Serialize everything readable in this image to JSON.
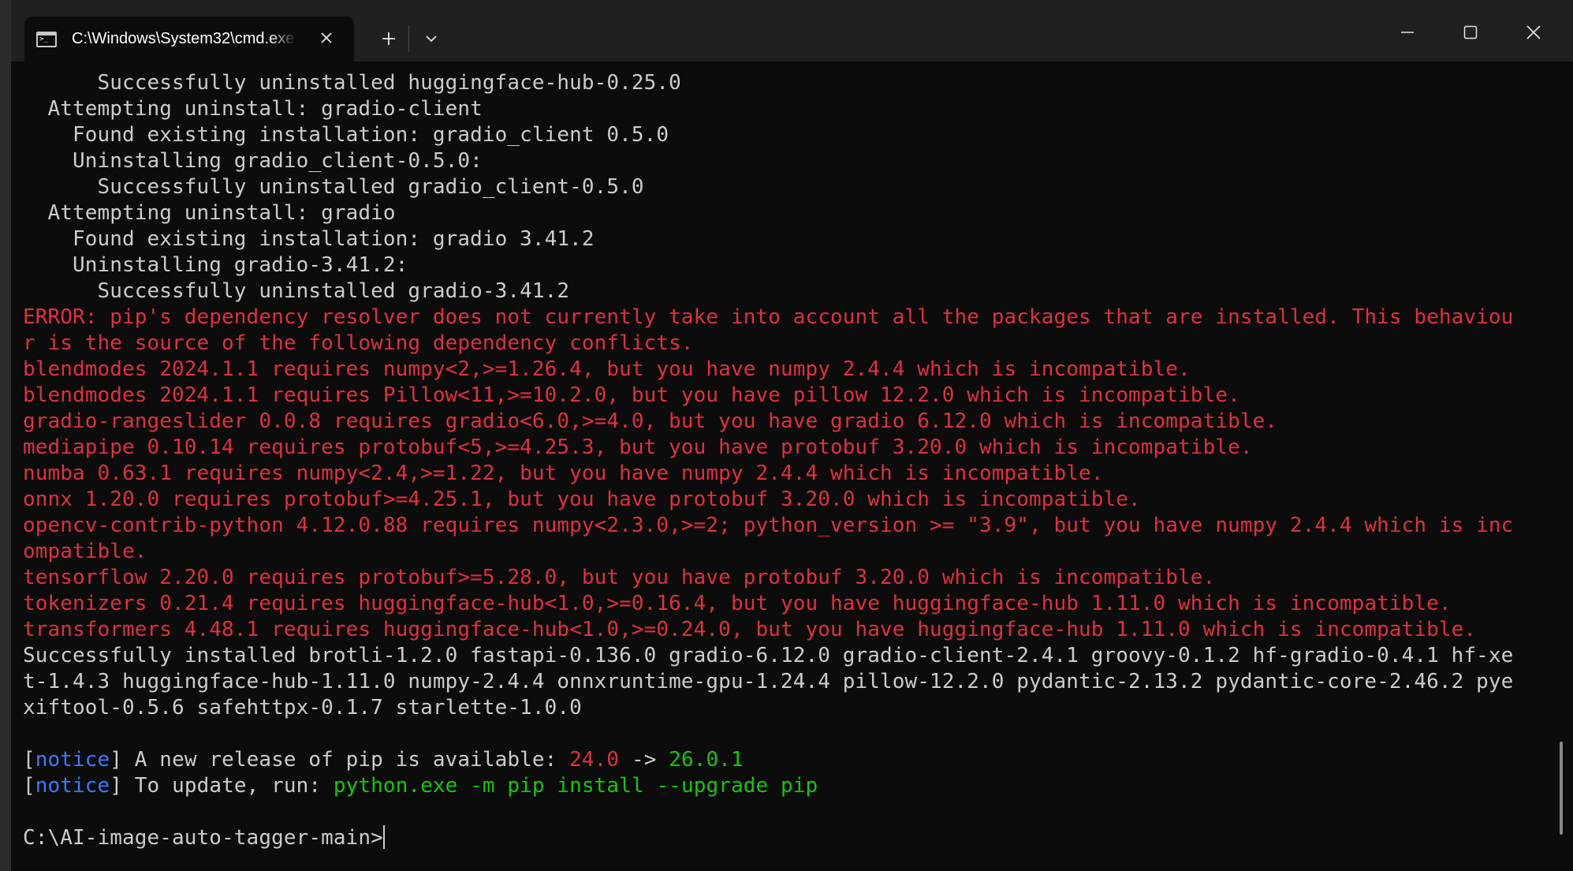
{
  "window": {
    "tab_title": "C:\\Windows\\System32\\cmd.exe",
    "tab_icon": "terminal-icon",
    "new_tab": "+",
    "colors": {
      "background": "#0c0c0c",
      "titlebar": "#202020",
      "text": "#cccccc",
      "error": "#e0303f",
      "success": "#16c60c",
      "notice": "#3b78ff"
    }
  },
  "terminal": {
    "lines": [
      {
        "segments": [
          {
            "text": "      Successfully uninstalled huggingface-hub-0.25.0",
            "color": "white"
          }
        ]
      },
      {
        "segments": [
          {
            "text": "  Attempting uninstall: gradio-client",
            "color": "white"
          }
        ]
      },
      {
        "segments": [
          {
            "text": "    Found existing installation: gradio_client 0.5.0",
            "color": "white"
          }
        ]
      },
      {
        "segments": [
          {
            "text": "    Uninstalling gradio_client-0.5.0:",
            "color": "white"
          }
        ]
      },
      {
        "segments": [
          {
            "text": "      Successfully uninstalled gradio_client-0.5.0",
            "color": "white"
          }
        ]
      },
      {
        "segments": [
          {
            "text": "  Attempting uninstall: gradio",
            "color": "white"
          }
        ]
      },
      {
        "segments": [
          {
            "text": "    Found existing installation: gradio 3.41.2",
            "color": "white"
          }
        ]
      },
      {
        "segments": [
          {
            "text": "    Uninstalling gradio-3.41.2:",
            "color": "white"
          }
        ]
      },
      {
        "segments": [
          {
            "text": "      Successfully uninstalled gradio-3.41.2",
            "color": "white"
          }
        ]
      },
      {
        "segments": [
          {
            "text": "ERROR: pip's dependency resolver does not currently take into account all the packages that are installed. This behaviou",
            "color": "red"
          }
        ]
      },
      {
        "segments": [
          {
            "text": "r is the source of the following dependency conflicts.",
            "color": "red"
          }
        ]
      },
      {
        "segments": [
          {
            "text": "blendmodes 2024.1.1 requires numpy<2,>=1.26.4, but you have numpy 2.4.4 which is incompatible.",
            "color": "red"
          }
        ]
      },
      {
        "segments": [
          {
            "text": "blendmodes 2024.1.1 requires Pillow<11,>=10.2.0, but you have pillow 12.2.0 which is incompatible.",
            "color": "red"
          }
        ]
      },
      {
        "segments": [
          {
            "text": "gradio-rangeslider 0.0.8 requires gradio<6.0,>=4.0, but you have gradio 6.12.0 which is incompatible.",
            "color": "red"
          }
        ]
      },
      {
        "segments": [
          {
            "text": "mediapipe 0.10.14 requires protobuf<5,>=4.25.3, but you have protobuf 3.20.0 which is incompatible.",
            "color": "red"
          }
        ]
      },
      {
        "segments": [
          {
            "text": "numba 0.63.1 requires numpy<2.4,>=1.22, but you have numpy 2.4.4 which is incompatible.",
            "color": "red"
          }
        ]
      },
      {
        "segments": [
          {
            "text": "onnx 1.20.0 requires protobuf>=4.25.1, but you have protobuf 3.20.0 which is incompatible.",
            "color": "red"
          }
        ]
      },
      {
        "segments": [
          {
            "text": "opencv-contrib-python 4.12.0.88 requires numpy<2.3.0,>=2; python_version >= \"3.9\", but you have numpy 2.4.4 which is inc",
            "color": "red"
          }
        ]
      },
      {
        "segments": [
          {
            "text": "ompatible.",
            "color": "red"
          }
        ]
      },
      {
        "segments": [
          {
            "text": "tensorflow 2.20.0 requires protobuf>=5.28.0, but you have protobuf 3.20.0 which is incompatible.",
            "color": "red"
          }
        ]
      },
      {
        "segments": [
          {
            "text": "tokenizers 0.21.4 requires huggingface-hub<1.0,>=0.16.4, but you have huggingface-hub 1.11.0 which is incompatible.",
            "color": "red"
          }
        ]
      },
      {
        "segments": [
          {
            "text": "transformers 4.48.1 requires huggingface-hub<1.0,>=0.24.0, but you have huggingface-hub 1.11.0 which is incompatible.",
            "color": "red"
          }
        ]
      },
      {
        "segments": [
          {
            "text": "Successfully installed brotli-1.2.0 fastapi-0.136.0 gradio-6.12.0 gradio-client-2.4.1 groovy-0.1.2 hf-gradio-0.4.1 hf-xe",
            "color": "white"
          }
        ]
      },
      {
        "segments": [
          {
            "text": "t-1.4.3 huggingface-hub-1.11.0 numpy-2.4.4 onnxruntime-gpu-1.24.4 pillow-12.2.0 pydantic-2.13.2 pydantic-core-2.46.2 pye",
            "color": "white"
          }
        ]
      },
      {
        "segments": [
          {
            "text": "xiftool-0.5.6 safehttpx-0.1.7 starlette-1.0.0",
            "color": "white"
          }
        ]
      },
      {
        "segments": [
          {
            "text": "",
            "color": "white"
          }
        ]
      },
      {
        "segments": [
          {
            "text": "[",
            "color": "white"
          },
          {
            "text": "notice",
            "color": "blue"
          },
          {
            "text": "] A new release of pip is available: ",
            "color": "white"
          },
          {
            "text": "24.0",
            "color": "red"
          },
          {
            "text": " -> ",
            "color": "white"
          },
          {
            "text": "26.0.1",
            "color": "green"
          }
        ]
      },
      {
        "segments": [
          {
            "text": "[",
            "color": "white"
          },
          {
            "text": "notice",
            "color": "blue"
          },
          {
            "text": "] To update, run: ",
            "color": "white"
          },
          {
            "text": "python.exe -m pip install --upgrade pip",
            "color": "green"
          }
        ]
      },
      {
        "segments": [
          {
            "text": "",
            "color": "white"
          }
        ]
      },
      {
        "segments": [
          {
            "text": "C:\\AI-image-auto-tagger-main>",
            "color": "white"
          }
        ],
        "cursor": true
      }
    ]
  }
}
